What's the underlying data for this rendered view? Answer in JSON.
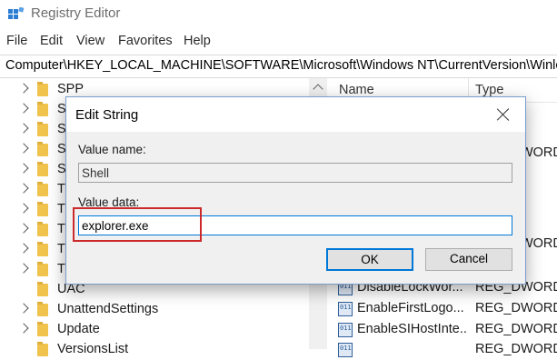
{
  "window": {
    "title": "Registry Editor"
  },
  "menu": [
    "File",
    "Edit",
    "View",
    "Favorites",
    "Help"
  ],
  "address": "Computer\\HKEY_LOCAL_MACHINE\\SOFTWARE\\Microsoft\\Windows NT\\CurrentVersion\\Winlo",
  "tree": {
    "items": [
      {
        "label": "SPP",
        "expandable": true
      },
      {
        "label": "S",
        "expandable": true
      },
      {
        "label": "S",
        "expandable": true
      },
      {
        "label": "S",
        "expandable": true
      },
      {
        "label": "S",
        "expandable": true
      },
      {
        "label": "T",
        "expandable": true
      },
      {
        "label": "T",
        "expandable": true
      },
      {
        "label": "T",
        "expandable": true
      },
      {
        "label": "T",
        "expandable": true
      },
      {
        "label": "Tr",
        "expandable": true
      },
      {
        "label": "UAC",
        "expandable": false
      },
      {
        "label": "UnattendSettings",
        "expandable": true
      },
      {
        "label": "Update",
        "expandable": true
      },
      {
        "label": "VersionsList",
        "expandable": false
      }
    ]
  },
  "list": {
    "columns": {
      "name": "Name",
      "type": "Type"
    },
    "rows": [
      {
        "name": "",
        "type": "REG_DWORD"
      },
      {
        "name": "",
        "type": "REG_DWORD"
      },
      {
        "name": "DisableLockWor...",
        "type": "REG_DWORD"
      },
      {
        "name": "EnableFirstLogo...",
        "type": "REG_DWORD"
      },
      {
        "name": "EnableSIHostInte...",
        "type": "REG_DWORD"
      },
      {
        "name": "",
        "type": "REG_DWORD"
      }
    ]
  },
  "dialog": {
    "title": "Edit String",
    "value_name_label": "Value name:",
    "value_name": "Shell",
    "value_data_label": "Value data:",
    "value_data": "explorer.exe",
    "ok_label": "OK",
    "cancel_label": "Cancel"
  },
  "colors": {
    "highlight": "#cc2a2a",
    "accent": "#0078d7",
    "folder": "#f0c44c"
  }
}
